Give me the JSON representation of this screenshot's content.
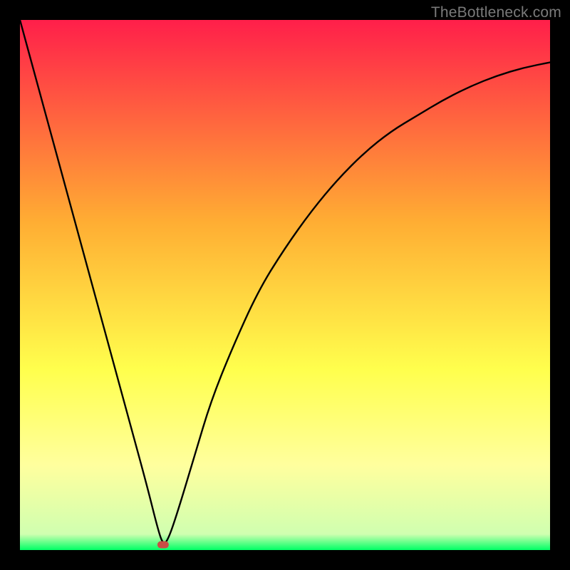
{
  "watermark": "TheBottleneck.com",
  "colors": {
    "top": "#ff1f4a",
    "mid_upper": "#ffad33",
    "mid_lower": "#ffff4d",
    "pale_band": "#ffff9e",
    "green": "#00ff66",
    "curve": "#000000",
    "marker": "#c94d45",
    "frame": "#000000"
  },
  "chart_data": {
    "type": "line",
    "title": "",
    "xlabel": "",
    "ylabel": "",
    "xlim": [
      0,
      100
    ],
    "ylim": [
      0,
      100
    ],
    "grid": false,
    "legend": false,
    "notes": "Background is a vertical spectrum from red (top, high bottleneck) through orange/yellow to green (bottom, no bottleneck). Curve shows bottleneck percentage vs. x; minimum ≈ 0 near x ≈ 27. Values estimated visually.",
    "series": [
      {
        "name": "bottleneck_curve",
        "color": "#000000",
        "x": [
          0,
          3,
          6,
          9,
          12,
          15,
          18,
          21,
          24,
          26,
          27,
          28,
          30,
          33,
          36,
          40,
          45,
          50,
          55,
          60,
          65,
          70,
          75,
          80,
          85,
          90,
          95,
          100
        ],
        "y": [
          100,
          89,
          78,
          67,
          56,
          45,
          34,
          23,
          12,
          4,
          1,
          2,
          8,
          18,
          28,
          38,
          49,
          57,
          64,
          70,
          75,
          79,
          82,
          85,
          87.5,
          89.5,
          91,
          92
        ]
      }
    ],
    "marker": {
      "x": 27,
      "y": 1,
      "color": "#c94d45",
      "shape": "pill"
    }
  }
}
